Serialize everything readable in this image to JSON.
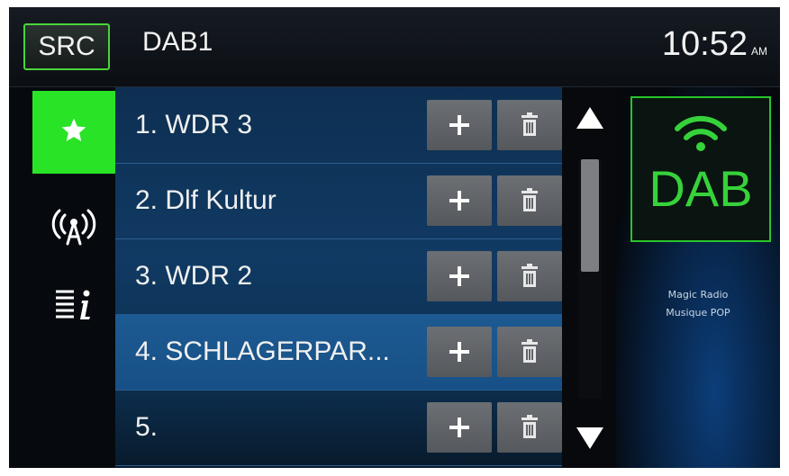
{
  "header": {
    "source_button_label": "SRC",
    "band_label": "DAB1",
    "clock_time": "10:52",
    "clock_ampm": "AM"
  },
  "sidebar": {
    "items": [
      {
        "icon": "star-icon",
        "selected": true
      },
      {
        "icon": "antenna-icon",
        "selected": false
      },
      {
        "icon": "info-list-icon",
        "selected": false
      }
    ]
  },
  "stations": [
    {
      "label": "1.  WDR 3",
      "selected": false
    },
    {
      "label": "2.  Dlf Kultur",
      "selected": false
    },
    {
      "label": "3.  WDR 2",
      "selected": false
    },
    {
      "label": "4.  SCHLAGERPAR...",
      "selected": true
    },
    {
      "label": "5.",
      "selected": false
    }
  ],
  "scroll": {
    "position_fraction": 0.0,
    "visible_fraction": 0.47
  },
  "now_playing": {
    "logo_text": "DAB",
    "info_line_1": "Magic Radio",
    "info_line_2": "Musique POP"
  },
  "colors": {
    "accent_green": "#29e326",
    "logo_green": "#36d23b",
    "list_blue": "#103a63",
    "selected_row_blue": "#1d5a92",
    "button_gray": "#616468"
  }
}
